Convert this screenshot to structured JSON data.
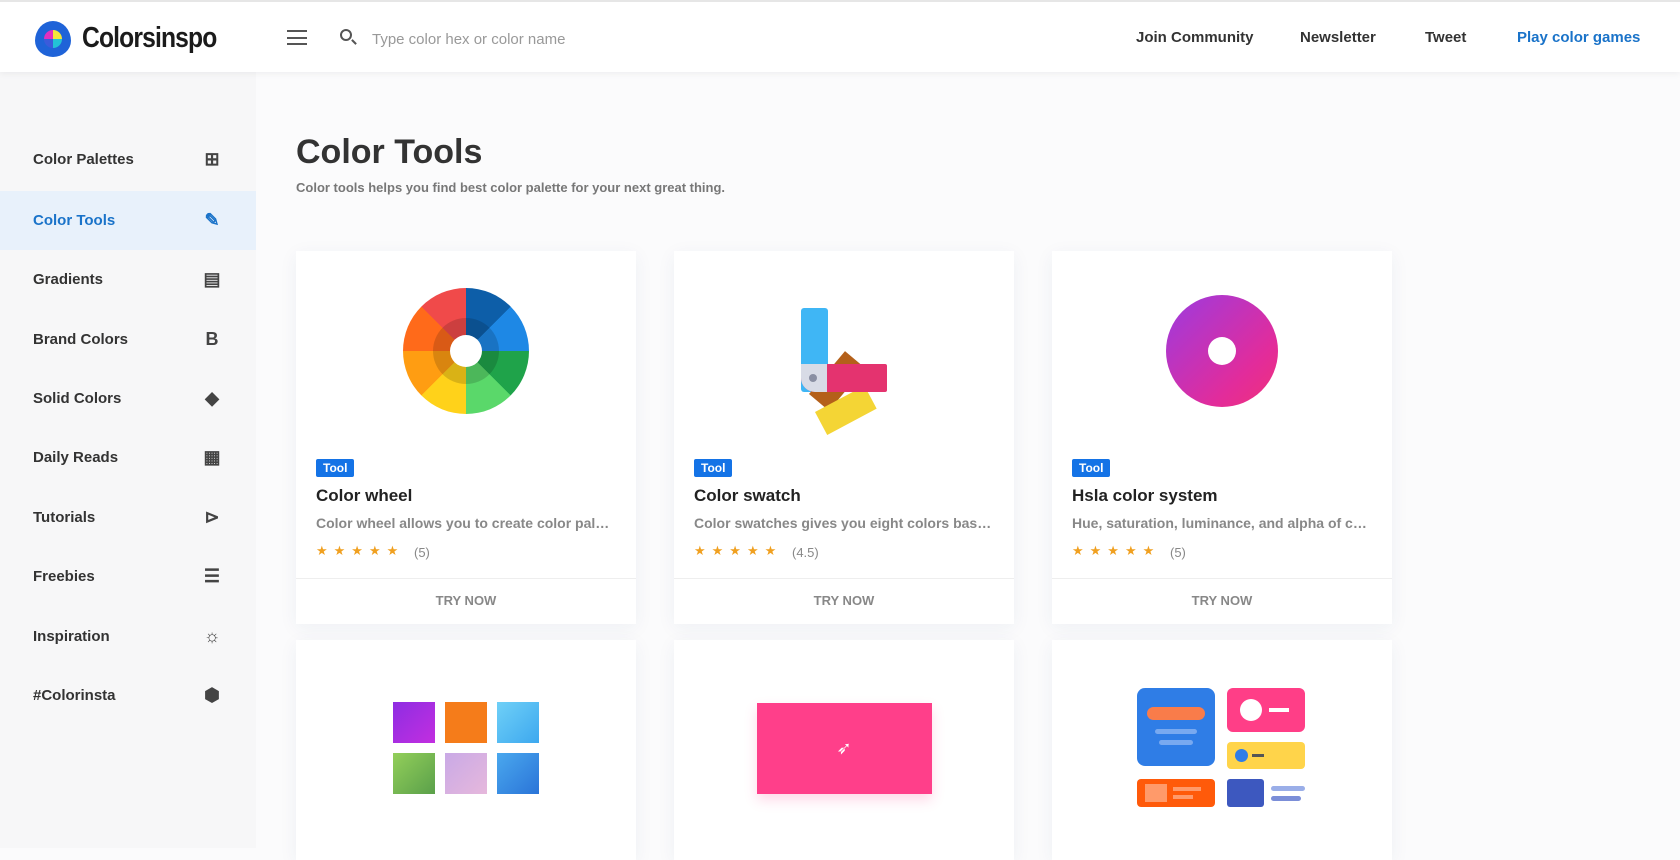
{
  "header": {
    "brand": "Colorsinspo",
    "search_placeholder": "Type color hex or color name",
    "nav": [
      "Join Community",
      "Newsletter",
      "Tweet",
      "Play color games"
    ],
    "accent": "#1a73c9"
  },
  "sidebar": {
    "items": [
      {
        "label": "Color Palettes",
        "icon": "grid-icon"
      },
      {
        "label": "Color Tools",
        "icon": "eyedropper-icon",
        "active": true
      },
      {
        "label": "Gradients",
        "icon": "image-icon"
      },
      {
        "label": "Brand Colors",
        "icon": "bold-b-icon"
      },
      {
        "label": "Solid Colors",
        "icon": "paint-bucket-icon"
      },
      {
        "label": "Daily Reads",
        "icon": "newspaper-icon"
      },
      {
        "label": "Tutorials",
        "icon": "play-video-icon"
      },
      {
        "label": "Freebies",
        "icon": "layout-icon"
      },
      {
        "label": "Inspiration",
        "icon": "lightbulb-icon"
      },
      {
        "label": "#Colorinsta",
        "icon": "cube-icon"
      }
    ]
  },
  "main": {
    "title": "Color Tools",
    "subtitle": "Color tools helps you find best color palette for your next great thing.",
    "cards": [
      {
        "badge": "Tool",
        "title": "Color wheel",
        "desc": "Color wheel allows you to create color palettes",
        "stars": "★★★★★",
        "rating": "(5)",
        "cta": "TRY NOW"
      },
      {
        "badge": "Tool",
        "title": "Color swatch",
        "desc": "Color swatches gives you eight colors based on",
        "stars": "★★★★★",
        "rating": "(4.5)",
        "cta": "TRY NOW"
      },
      {
        "badge": "Tool",
        "title": "Hsla color system",
        "desc": "Hue, saturation, luminance, and alpha of colors",
        "stars": "★★★★★",
        "rating": "(5)",
        "cta": "TRY NOW"
      }
    ]
  }
}
